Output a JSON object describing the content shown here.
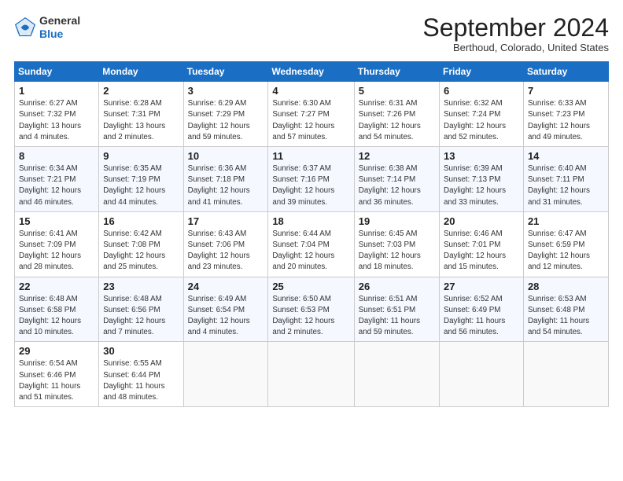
{
  "header": {
    "logo_line1": "General",
    "logo_line2": "Blue",
    "month_title": "September 2024",
    "location": "Berthoud, Colorado, United States"
  },
  "weekdays": [
    "Sunday",
    "Monday",
    "Tuesday",
    "Wednesday",
    "Thursday",
    "Friday",
    "Saturday"
  ],
  "weeks": [
    [
      {
        "day": "1",
        "detail": "Sunrise: 6:27 AM\nSunset: 7:32 PM\nDaylight: 13 hours\nand 4 minutes."
      },
      {
        "day": "2",
        "detail": "Sunrise: 6:28 AM\nSunset: 7:31 PM\nDaylight: 13 hours\nand 2 minutes."
      },
      {
        "day": "3",
        "detail": "Sunrise: 6:29 AM\nSunset: 7:29 PM\nDaylight: 12 hours\nand 59 minutes."
      },
      {
        "day": "4",
        "detail": "Sunrise: 6:30 AM\nSunset: 7:27 PM\nDaylight: 12 hours\nand 57 minutes."
      },
      {
        "day": "5",
        "detail": "Sunrise: 6:31 AM\nSunset: 7:26 PM\nDaylight: 12 hours\nand 54 minutes."
      },
      {
        "day": "6",
        "detail": "Sunrise: 6:32 AM\nSunset: 7:24 PM\nDaylight: 12 hours\nand 52 minutes."
      },
      {
        "day": "7",
        "detail": "Sunrise: 6:33 AM\nSunset: 7:23 PM\nDaylight: 12 hours\nand 49 minutes."
      }
    ],
    [
      {
        "day": "8",
        "detail": "Sunrise: 6:34 AM\nSunset: 7:21 PM\nDaylight: 12 hours\nand 46 minutes."
      },
      {
        "day": "9",
        "detail": "Sunrise: 6:35 AM\nSunset: 7:19 PM\nDaylight: 12 hours\nand 44 minutes."
      },
      {
        "day": "10",
        "detail": "Sunrise: 6:36 AM\nSunset: 7:18 PM\nDaylight: 12 hours\nand 41 minutes."
      },
      {
        "day": "11",
        "detail": "Sunrise: 6:37 AM\nSunset: 7:16 PM\nDaylight: 12 hours\nand 39 minutes."
      },
      {
        "day": "12",
        "detail": "Sunrise: 6:38 AM\nSunset: 7:14 PM\nDaylight: 12 hours\nand 36 minutes."
      },
      {
        "day": "13",
        "detail": "Sunrise: 6:39 AM\nSunset: 7:13 PM\nDaylight: 12 hours\nand 33 minutes."
      },
      {
        "day": "14",
        "detail": "Sunrise: 6:40 AM\nSunset: 7:11 PM\nDaylight: 12 hours\nand 31 minutes."
      }
    ],
    [
      {
        "day": "15",
        "detail": "Sunrise: 6:41 AM\nSunset: 7:09 PM\nDaylight: 12 hours\nand 28 minutes."
      },
      {
        "day": "16",
        "detail": "Sunrise: 6:42 AM\nSunset: 7:08 PM\nDaylight: 12 hours\nand 25 minutes."
      },
      {
        "day": "17",
        "detail": "Sunrise: 6:43 AM\nSunset: 7:06 PM\nDaylight: 12 hours\nand 23 minutes."
      },
      {
        "day": "18",
        "detail": "Sunrise: 6:44 AM\nSunset: 7:04 PM\nDaylight: 12 hours\nand 20 minutes."
      },
      {
        "day": "19",
        "detail": "Sunrise: 6:45 AM\nSunset: 7:03 PM\nDaylight: 12 hours\nand 18 minutes."
      },
      {
        "day": "20",
        "detail": "Sunrise: 6:46 AM\nSunset: 7:01 PM\nDaylight: 12 hours\nand 15 minutes."
      },
      {
        "day": "21",
        "detail": "Sunrise: 6:47 AM\nSunset: 6:59 PM\nDaylight: 12 hours\nand 12 minutes."
      }
    ],
    [
      {
        "day": "22",
        "detail": "Sunrise: 6:48 AM\nSunset: 6:58 PM\nDaylight: 12 hours\nand 10 minutes."
      },
      {
        "day": "23",
        "detail": "Sunrise: 6:48 AM\nSunset: 6:56 PM\nDaylight: 12 hours\nand 7 minutes."
      },
      {
        "day": "24",
        "detail": "Sunrise: 6:49 AM\nSunset: 6:54 PM\nDaylight: 12 hours\nand 4 minutes."
      },
      {
        "day": "25",
        "detail": "Sunrise: 6:50 AM\nSunset: 6:53 PM\nDaylight: 12 hours\nand 2 minutes."
      },
      {
        "day": "26",
        "detail": "Sunrise: 6:51 AM\nSunset: 6:51 PM\nDaylight: 11 hours\nand 59 minutes."
      },
      {
        "day": "27",
        "detail": "Sunrise: 6:52 AM\nSunset: 6:49 PM\nDaylight: 11 hours\nand 56 minutes."
      },
      {
        "day": "28",
        "detail": "Sunrise: 6:53 AM\nSunset: 6:48 PM\nDaylight: 11 hours\nand 54 minutes."
      }
    ],
    [
      {
        "day": "29",
        "detail": "Sunrise: 6:54 AM\nSunset: 6:46 PM\nDaylight: 11 hours\nand 51 minutes."
      },
      {
        "day": "30",
        "detail": "Sunrise: 6:55 AM\nSunset: 6:44 PM\nDaylight: 11 hours\nand 48 minutes."
      },
      {
        "day": "",
        "detail": ""
      },
      {
        "day": "",
        "detail": ""
      },
      {
        "day": "",
        "detail": ""
      },
      {
        "day": "",
        "detail": ""
      },
      {
        "day": "",
        "detail": ""
      }
    ]
  ]
}
